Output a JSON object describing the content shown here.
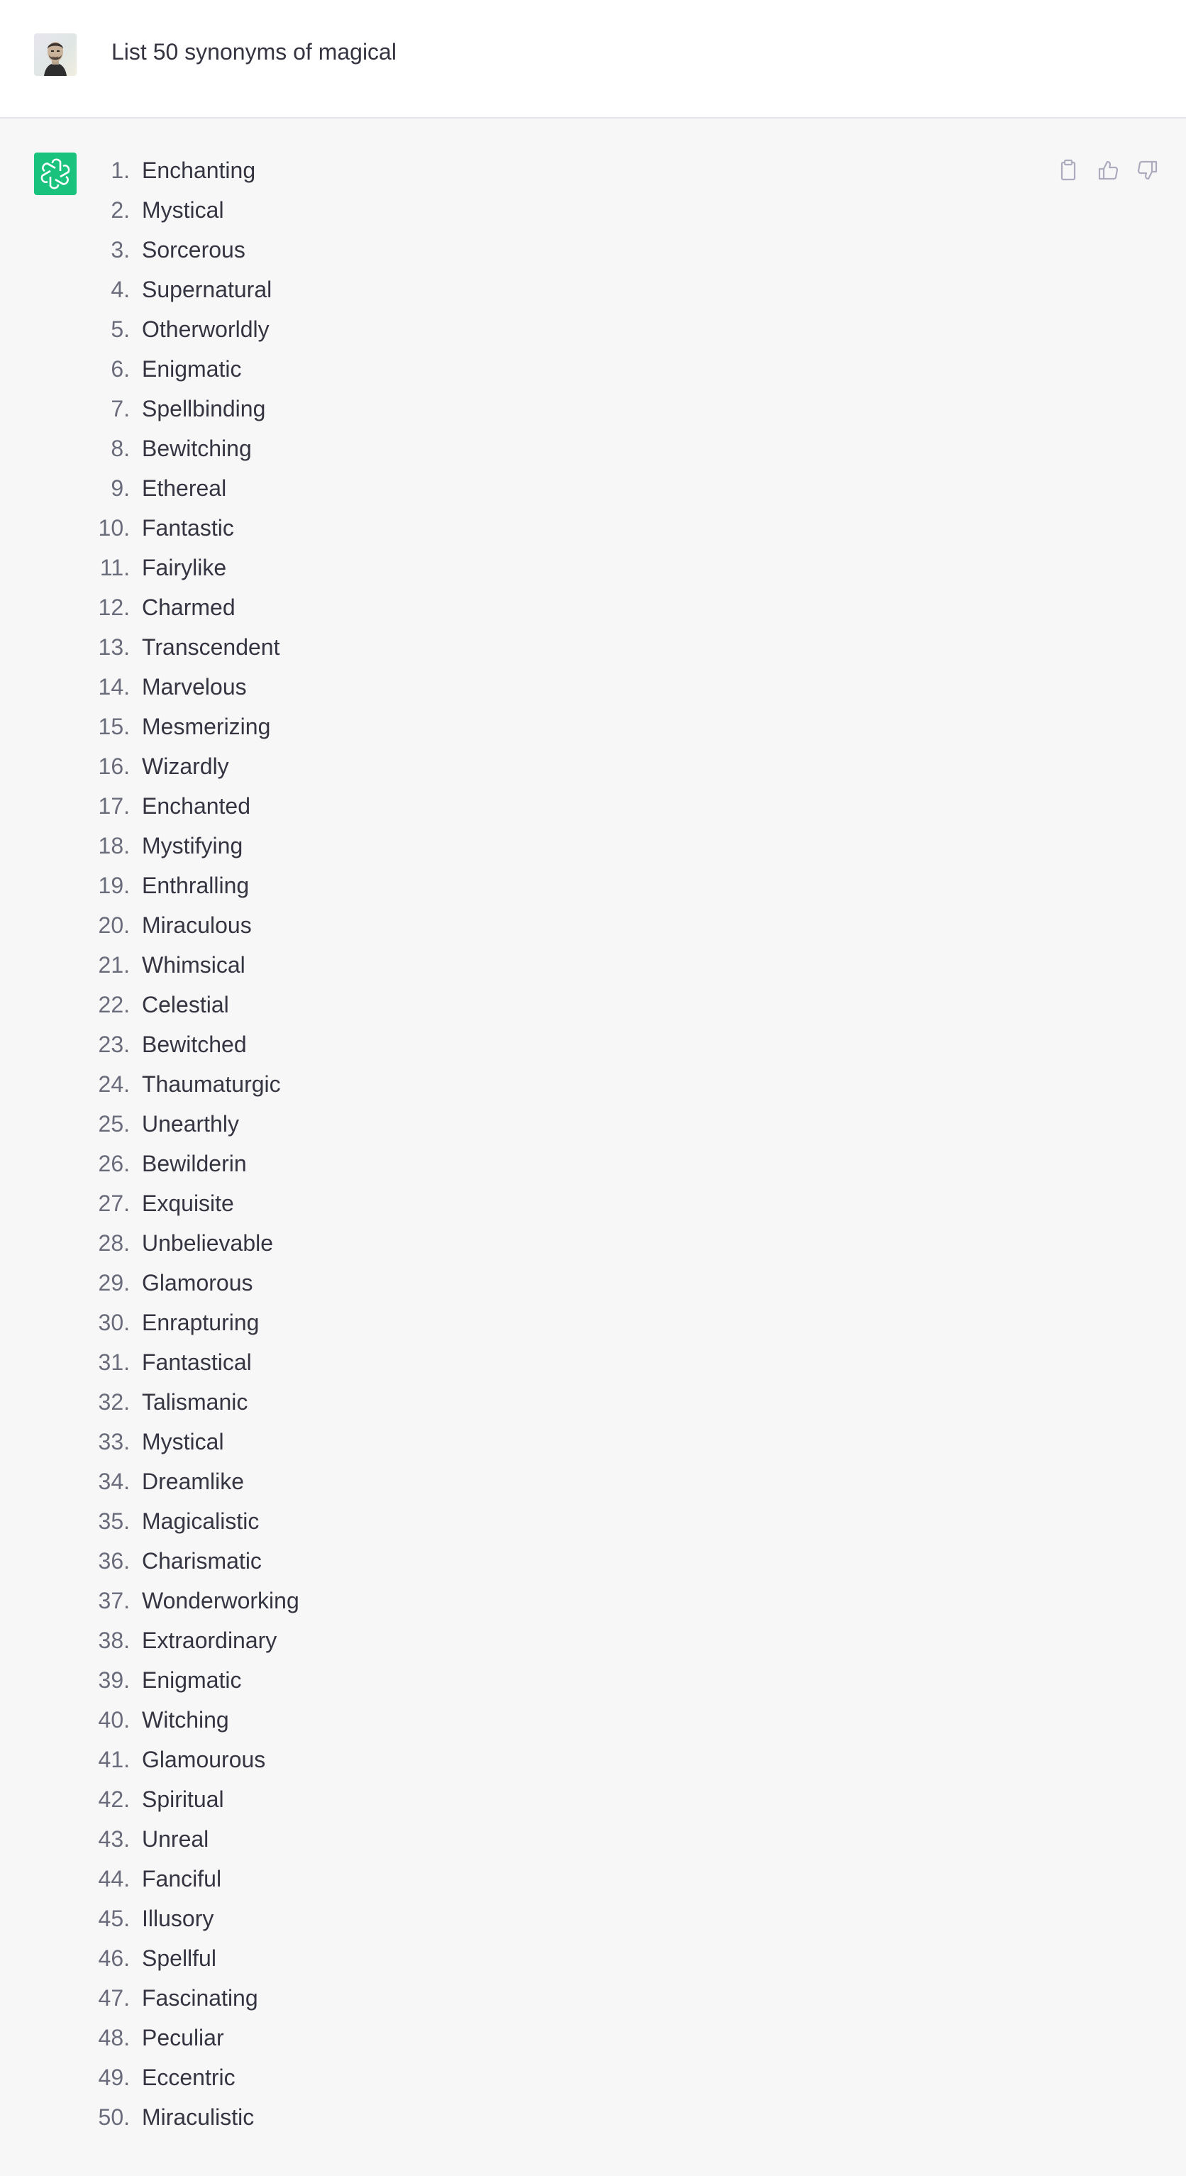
{
  "user_message": {
    "avatar_icon": "user-photo-avatar",
    "text": "List 50 synonyms of magical"
  },
  "assistant_message": {
    "avatar_icon": "chatgpt-logo-icon",
    "avatar_color": "#19c37d",
    "actions": [
      {
        "icon": "clipboard-icon",
        "label": "Copy"
      },
      {
        "icon": "thumbs-up-icon",
        "label": "Like"
      },
      {
        "icon": "thumbs-down-icon",
        "label": "Dislike"
      }
    ],
    "items": [
      {
        "num": "1.",
        "text": "Enchanting"
      },
      {
        "num": "2.",
        "text": "Mystical"
      },
      {
        "num": "3.",
        "text": "Sorcerous"
      },
      {
        "num": "4.",
        "text": "Supernatural"
      },
      {
        "num": "5.",
        "text": "Otherworldly"
      },
      {
        "num": "6.",
        "text": "Enigmatic"
      },
      {
        "num": "7.",
        "text": "Spellbinding"
      },
      {
        "num": "8.",
        "text": "Bewitching"
      },
      {
        "num": "9.",
        "text": "Ethereal"
      },
      {
        "num": "10.",
        "text": "Fantastic"
      },
      {
        "num": "11.",
        "text": "Fairylike"
      },
      {
        "num": "12.",
        "text": "Charmed"
      },
      {
        "num": "13.",
        "text": "Transcendent"
      },
      {
        "num": "14.",
        "text": "Marvelous"
      },
      {
        "num": "15.",
        "text": "Mesmerizing"
      },
      {
        "num": "16.",
        "text": "Wizardly"
      },
      {
        "num": "17.",
        "text": "Enchanted"
      },
      {
        "num": "18.",
        "text": "Mystifying"
      },
      {
        "num": "19.",
        "text": "Enthralling"
      },
      {
        "num": "20.",
        "text": "Miraculous"
      },
      {
        "num": "21.",
        "text": "Whimsical"
      },
      {
        "num": "22.",
        "text": "Celestial"
      },
      {
        "num": "23.",
        "text": "Bewitched"
      },
      {
        "num": "24.",
        "text": "Thaumaturgic"
      },
      {
        "num": "25.",
        "text": "Unearthly"
      },
      {
        "num": "26.",
        "text": "Bewilderin"
      },
      {
        "num": "27.",
        "text": "Exquisite"
      },
      {
        "num": "28.",
        "text": "Unbelievable"
      },
      {
        "num": "29.",
        "text": "Glamorous"
      },
      {
        "num": "30.",
        "text": "Enrapturing"
      },
      {
        "num": "31.",
        "text": "Fantastical"
      },
      {
        "num": "32.",
        "text": "Talismanic"
      },
      {
        "num": "33.",
        "text": "Mystical"
      },
      {
        "num": "34.",
        "text": "Dreamlike"
      },
      {
        "num": "35.",
        "text": "Magicalistic"
      },
      {
        "num": "36.",
        "text": "Charismatic"
      },
      {
        "num": "37.",
        "text": "Wonderworking"
      },
      {
        "num": "38.",
        "text": "Extraordinary"
      },
      {
        "num": "39.",
        "text": "Enigmatic"
      },
      {
        "num": "40.",
        "text": "Witching"
      },
      {
        "num": "41.",
        "text": "Glamourous"
      },
      {
        "num": "42.",
        "text": "Spiritual"
      },
      {
        "num": "43.",
        "text": "Unreal"
      },
      {
        "num": "44.",
        "text": "Fanciful"
      },
      {
        "num": "45.",
        "text": "Illusory"
      },
      {
        "num": "46.",
        "text": "Spellful"
      },
      {
        "num": "47.",
        "text": "Fascinating"
      },
      {
        "num": "48.",
        "text": "Peculiar"
      },
      {
        "num": "49.",
        "text": "Eccentric"
      },
      {
        "num": "50.",
        "text": "Miraculistic"
      }
    ]
  }
}
